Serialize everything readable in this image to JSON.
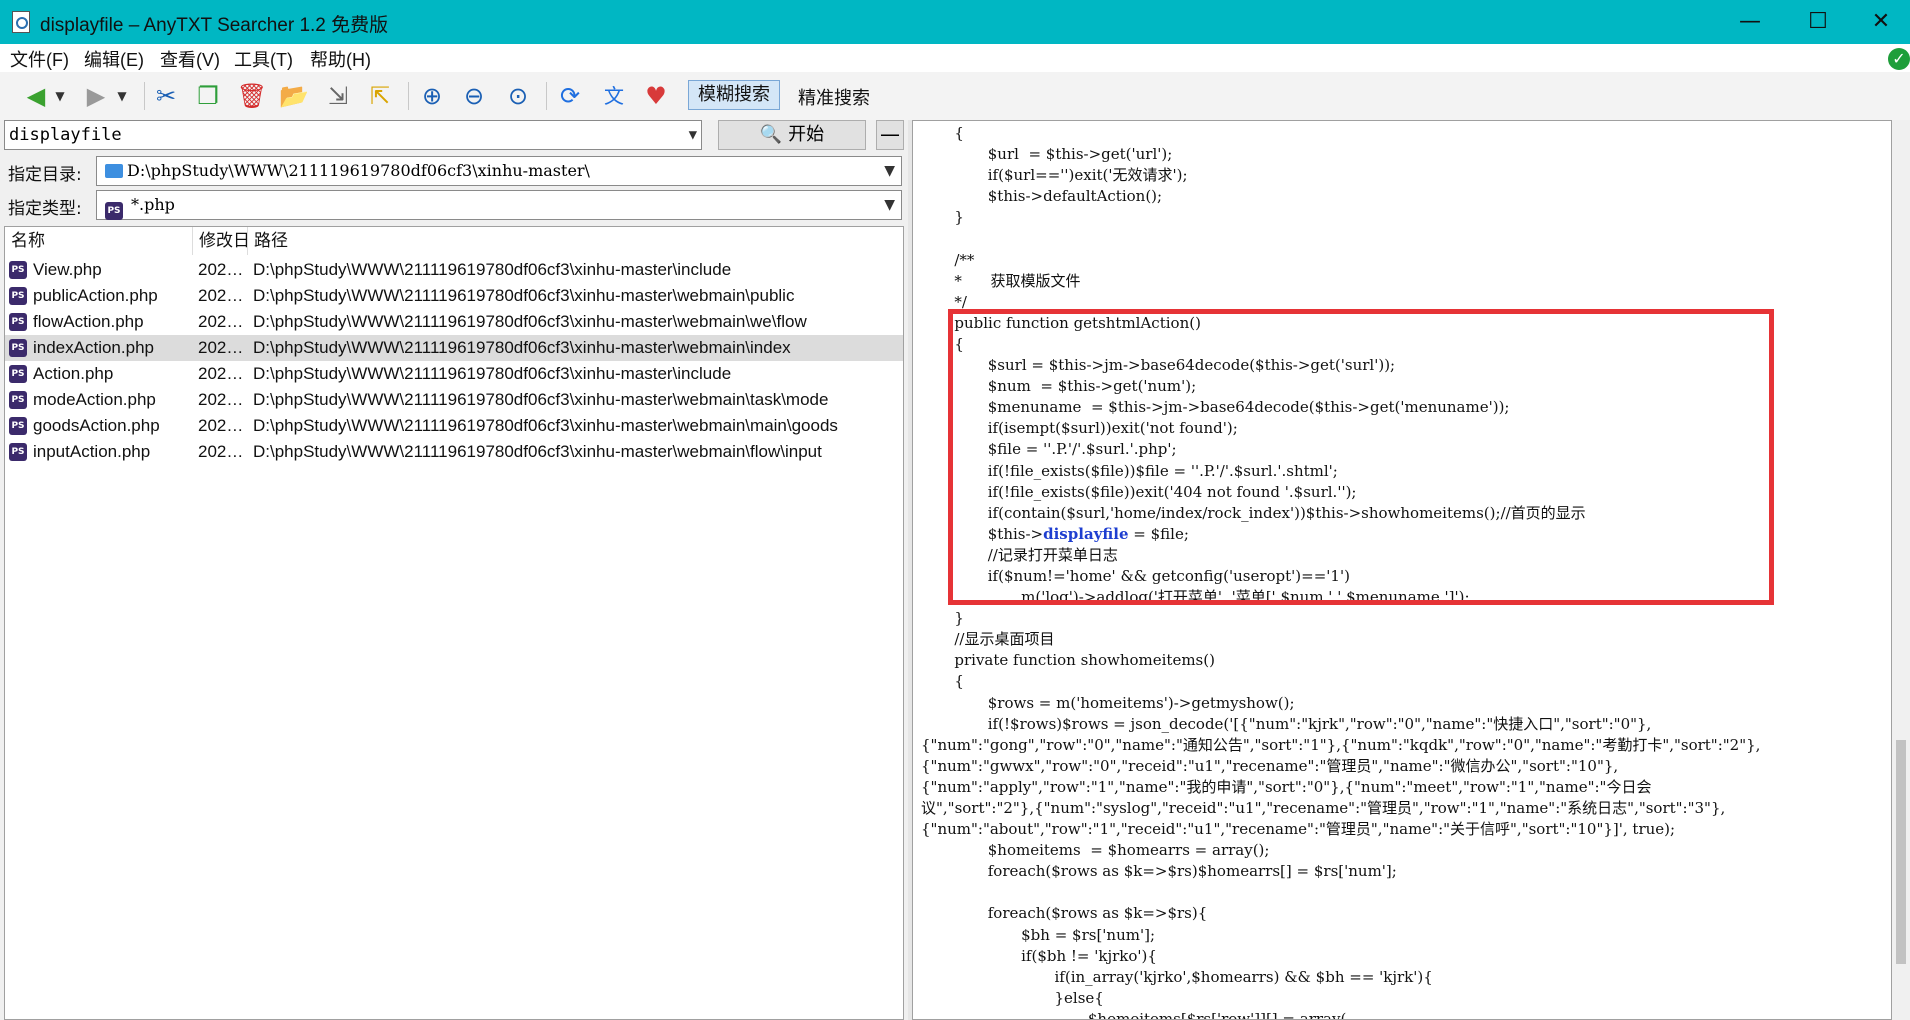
{
  "window": {
    "title": "displayfile  –  AnyTXT Searcher 1.2 免费版",
    "controls": {
      "minimize": "—",
      "maximize": "☐",
      "close": "✕"
    }
  },
  "menu": [
    "文件(F)",
    "编辑(E)",
    "查看(V)",
    "工具(T)",
    "帮助(H)"
  ],
  "toolbar": {
    "icons": [
      "back-icon",
      "forward-icon",
      "cut-icon",
      "copy-icon",
      "delete-icon",
      "open-folder-icon",
      "export-icon",
      "import-icon",
      "zoom-in-icon",
      "zoom-out-icon",
      "zoom-reset-icon",
      "refresh-icon",
      "translate-icon",
      "donate-heart-icon"
    ],
    "fuzzy_search": "模糊搜索",
    "exact_search": "精准搜索"
  },
  "search": {
    "query": "displayfile",
    "start_label": "开始",
    "collapse_label": "—"
  },
  "filters": {
    "dir_label": "指定目录:",
    "dir_value": "D:\\phpStudy\\WWW\\211119619780df06cf3\\xinhu-master\\",
    "type_label": "指定类型:",
    "type_value": "*.php"
  },
  "columns": {
    "name": "名称",
    "modified": "修改日",
    "path": "路径"
  },
  "files": [
    {
      "name": "View.php",
      "modified": "202…",
      "path": "D:\\phpStudy\\WWW\\211119619780df06cf3\\xinhu-master\\include"
    },
    {
      "name": "publicAction.php",
      "modified": "202…",
      "path": "D:\\phpStudy\\WWW\\211119619780df06cf3\\xinhu-master\\webmain\\public"
    },
    {
      "name": "flowAction.php",
      "modified": "202…",
      "path": "D:\\phpStudy\\WWW\\211119619780df06cf3\\xinhu-master\\webmain\\we\\flow"
    },
    {
      "name": "indexAction.php",
      "modified": "202…",
      "path": "D:\\phpStudy\\WWW\\211119619780df06cf3\\xinhu-master\\webmain\\index"
    },
    {
      "name": "Action.php",
      "modified": "202…",
      "path": "D:\\phpStudy\\WWW\\211119619780df06cf3\\xinhu-master\\include"
    },
    {
      "name": "modeAction.php",
      "modified": "202…",
      "path": "D:\\phpStudy\\WWW\\211119619780df06cf3\\xinhu-master\\webmain\\task\\mode"
    },
    {
      "name": "goodsAction.php",
      "modified": "202…",
      "path": "D:\\phpStudy\\WWW\\211119619780df06cf3\\xinhu-master\\webmain\\main\\goods"
    },
    {
      "name": "inputAction.php",
      "modified": "202…",
      "path": "D:\\phpStudy\\WWW\\211119619780df06cf3\\xinhu-master\\webmain\\flow\\input"
    }
  ],
  "selected_file_index": 3,
  "code_lines": [
    "       {",
    "              $url  = $this->get('url');",
    "              if($url=='')exit('无效请求');",
    "              $this->defaultAction();",
    "       }",
    "",
    "       /**",
    "       *      获取模版文件",
    "       */",
    "       public function getshtmlAction()",
    "       {",
    "              $surl = $this->jm->base64decode($this->get('surl'));",
    "              $num  = $this->get('num');",
    "              $menuname  = $this->jm->base64decode($this->get('menuname'));",
    "              if(isempt($surl))exit('not found');",
    "              $file = ''.P.'/'.$surl.'.php';",
    "              if(!file_exists($file))$file = ''.P.'/'.$surl.'.shtml';",
    "              if(!file_exists($file))exit('404 not found '.$surl.'');",
    "              if(contain($surl,'home/index/rock_index'))$this->showhomeitems();//首页的显示",
    "              $this->displayfile = $file;",
    "              //记录打开菜单日志",
    "              if($num!='home' && getconfig('useropt')=='1')",
    "                     m('log')->addlog('打开菜单', '菜单['.$num.'.'.$menuname.']');",
    "       }",
    "       //显示桌面项目",
    "       private function showhomeitems()",
    "       {",
    "              $rows = m('homeitems')->getmyshow();",
    "              if(!$rows)$rows = json_decode('[{\"num\":\"kjrk\",\"row\":\"0\",\"name\":\"快捷入口\",\"sort\":\"0\"},",
    "{\"num\":\"gong\",\"row\":\"0\",\"name\":\"通知公告\",\"sort\":\"1\"},{\"num\":\"kqdk\",\"row\":\"0\",\"name\":\"考勤打卡\",\"sort\":\"2\"},",
    "{\"num\":\"gwwx\",\"row\":\"0\",\"receid\":\"u1\",\"recename\":\"管理员\",\"name\":\"微信办公\",\"sort\":\"10\"},",
    "{\"num\":\"apply\",\"row\":\"1\",\"name\":\"我的申请\",\"sort\":\"0\"},{\"num\":\"meet\",\"row\":\"1\",\"name\":\"今日会",
    "议\",\"sort\":\"2\"},{\"num\":\"syslog\",\"receid\":\"u1\",\"recename\":\"管理员\",\"row\":\"1\",\"name\":\"系统日志\",\"sort\":\"3\"},",
    "{\"num\":\"about\",\"row\":\"1\",\"receid\":\"u1\",\"recename\":\"管理员\",\"name\":\"关于信呼\",\"sort\":\"10\"}]', true);",
    "              $homeitems  = $homearrs = array();",
    "              foreach($rows as $k=>$rs)$homearrs[] = $rs['num'];",
    "",
    "              foreach($rows as $k=>$rs){",
    "                     $bh = $rs['num'];",
    "                     if($bh != 'kjrko'){",
    "                            if(in_array('kjrko',$homearrs) && $bh == 'kjrk'){",
    "                            }else{",
    "                                   $homeitems[$rs['row']][] = array("
  ],
  "highlight": {
    "line_index": 19,
    "term": "displayfile"
  }
}
